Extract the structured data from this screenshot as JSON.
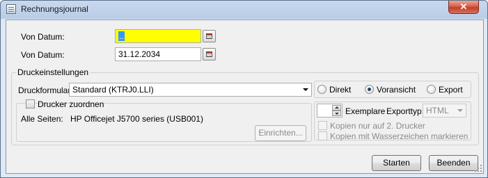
{
  "window": {
    "title": "Rechnungsjournal",
    "close_label": "✕"
  },
  "dates": {
    "from_label": "Von Datum:",
    "from_value": "..",
    "to_label": "Von Datum:",
    "to_value": "31.12.2034"
  },
  "print_settings": {
    "group_title": "Druckeinstellungen",
    "form_label": "Druckformular:",
    "form_value": "Standard (KTRJ0.LLI)",
    "output": {
      "options": [
        "Direkt",
        "Voransicht",
        "Export"
      ],
      "selected": "Voransicht"
    },
    "printer": {
      "assign_label": "Drucker zuordnen",
      "assign_checked": false,
      "all_pages_label": "Alle Seiten:",
      "printer_name": "HP Officejet J5700 series (USB001)",
      "setup_label": "Einrichten..."
    },
    "copies": {
      "count_value": "",
      "label": "Exemplare",
      "export_type_label": "Exporttyp:",
      "export_type_value": "HTML",
      "only_second_printer_label": "Kopien nur auf 2. Drucker",
      "watermark_label": "Kopien mit Wasserzeichen markieren"
    }
  },
  "actions": {
    "start_label": "Starten",
    "quit_label": "Beenden"
  },
  "colors": {
    "highlight_field": "#ffff00",
    "selection": "#3399ff"
  }
}
